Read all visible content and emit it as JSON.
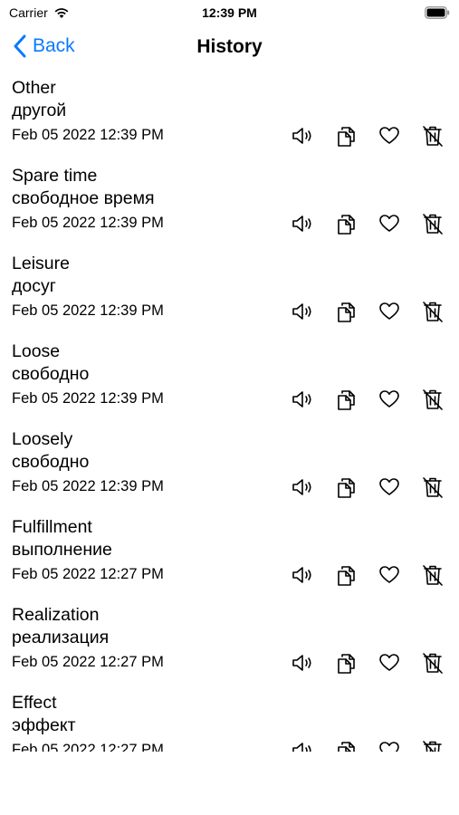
{
  "status_bar": {
    "carrier": "Carrier",
    "time": "12:39 PM"
  },
  "nav": {
    "back_label": "Back",
    "title": "History"
  },
  "icons": {
    "speaker": "speaker-icon",
    "copy": "copy-icon",
    "favorite": "heart-icon",
    "delete": "trash-icon"
  },
  "colors": {
    "accent": "#0a7aff"
  },
  "history": [
    {
      "word": "Other",
      "translation": "другой",
      "date": "Feb 05 2022 12:39 PM"
    },
    {
      "word": "Spare time",
      "translation": "свободное время",
      "date": "Feb 05 2022 12:39 PM"
    },
    {
      "word": "Leisure",
      "translation": "досуг",
      "date": "Feb 05 2022 12:39 PM"
    },
    {
      "word": "Loose",
      "translation": "свободно",
      "date": "Feb 05 2022 12:39 PM"
    },
    {
      "word": "Loosely",
      "translation": "свободно",
      "date": "Feb 05 2022 12:39 PM"
    },
    {
      "word": "Fulfillment",
      "translation": "выполнение",
      "date": "Feb 05 2022 12:27 PM"
    },
    {
      "word": "Realization",
      "translation": "реализация",
      "date": "Feb 05 2022 12:27 PM"
    },
    {
      "word": "Effect",
      "translation": "эффект",
      "date": "Feb 05 2022 12:27 PM"
    }
  ]
}
